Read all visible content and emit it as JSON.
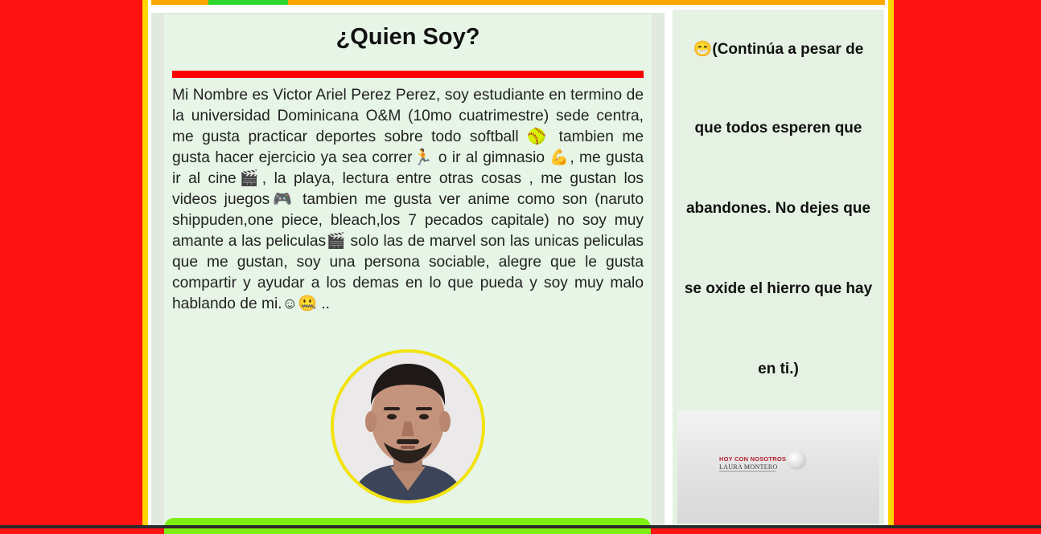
{
  "header": {
    "title": "¿Quien Soy?"
  },
  "bio": {
    "text": "Mi Nombre es Victor Ariel Perez Perez, soy estudiante en termino de la universidad Dominicana O&M (10mo cuatrimestre) sede centra, me gusta practicar deportes sobre todo softball 🥎 tambien me gusta hacer ejercicio ya sea correr🏃 o ir al gimnasio 💪, me gusta ir al cine🎬, la playa, lectura entre otras cosas , me gustan los videos juegos🎮  tambien me gusta ver anime como son (naruto shippuden,one piece, bleach,los 7 pecados capitale) no soy muy amante a las peliculas🎬 solo las de marvel son las unicas peliculas que me gustan, soy una persona sociable, alegre que le gusta compartir y ayudar a los demas en lo que pueda y soy muy malo hablando de mi.☺🤐 .."
  },
  "profile": {
    "photo_icon": "profile-photo"
  },
  "sidebar": {
    "quote_lines": [
      "😁(Continúa a pesar de",
      "que todos esperen que",
      "abandones. No dejes que",
      "se oxide el hierro que hay",
      "en ti.)"
    ],
    "thumbnail": {
      "headline": "HOY CON NOSOTROS",
      "name": "LAURA MONTERO"
    }
  },
  "colors": {
    "background": "#ff1212",
    "frame": "#ffd600",
    "topbar": "#ffa500",
    "topbar_accent": "#2ed62e",
    "rule": "#ff0000",
    "card": "#e6f5e6",
    "footer_bar": "#7eef12"
  }
}
